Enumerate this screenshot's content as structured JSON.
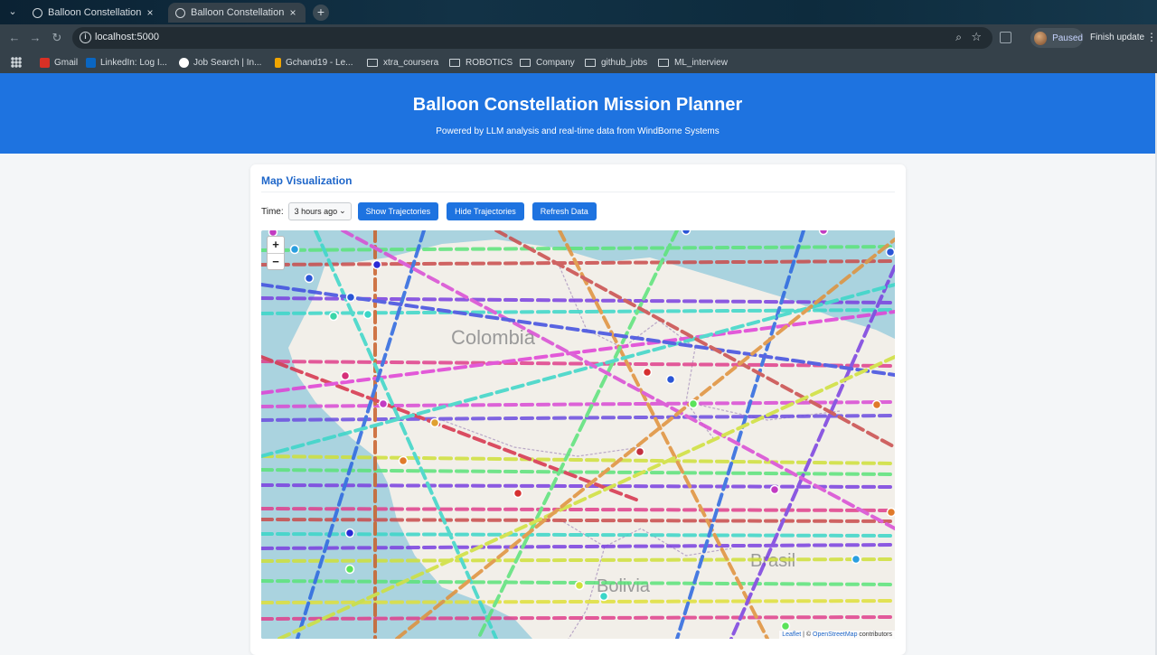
{
  "browser": {
    "tabs": [
      {
        "title": "Balloon Constellation Mi"
      },
      {
        "title": "Balloon Constellation Mi"
      }
    ],
    "new_tab": "+",
    "url": "localhost:5000",
    "profile_status": "Paused",
    "finish_update": "Finish update",
    "bookmarks": [
      {
        "label": "Gmail",
        "kind": "site",
        "color": "#d93025"
      },
      {
        "label": "LinkedIn: Log I...",
        "kind": "site",
        "color": "#0a66c2"
      },
      {
        "label": "Job Search | In...",
        "kind": "site",
        "color": "#ffffff"
      },
      {
        "label": "Gchand19 - Le...",
        "kind": "site",
        "color": "#f0a500"
      },
      {
        "label": "xtra_coursera",
        "kind": "folder"
      },
      {
        "label": "ROBOTICS",
        "kind": "folder"
      },
      {
        "label": "Company",
        "kind": "folder"
      },
      {
        "label": "github_jobs",
        "kind": "folder"
      },
      {
        "label": "ML_interview",
        "kind": "folder"
      }
    ]
  },
  "header": {
    "title": "Balloon Constellation Mission Planner",
    "subtitle": "Powered by LLM analysis and real-time data from WindBorne Systems"
  },
  "map_panel": {
    "heading": "Map Visualization",
    "time_label": "Time:",
    "time_selected": "3 hours ago",
    "buttons": {
      "show": "Show Trajectories",
      "hide": "Hide Trajectories",
      "refresh": "Refresh Data"
    },
    "zoom_in": "+",
    "zoom_out": "−",
    "attribution": {
      "leaflet": "Leaflet",
      "sep": " | © ",
      "osm": "OpenStreetMap",
      "tail": " contributors"
    },
    "country_labels": [
      "Colombia",
      "Brasil",
      "Bolivia"
    ]
  },
  "colors": {
    "accent": "#1e73e0",
    "ocean": "#aad3df",
    "land": "#f2efe9"
  }
}
